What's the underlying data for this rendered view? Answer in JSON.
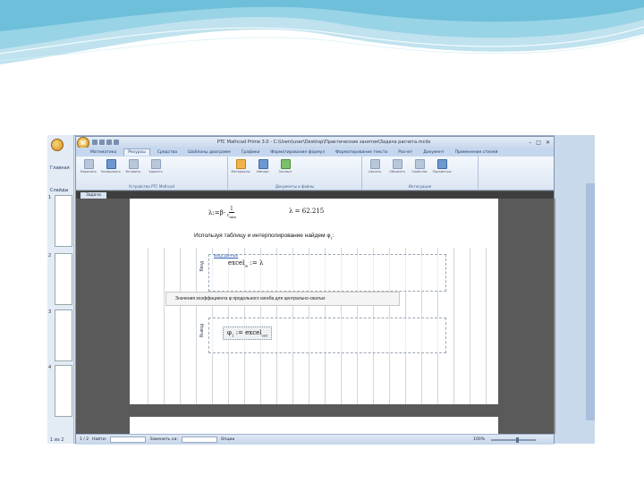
{
  "outer_window": {
    "panel_labels": [
      "Главная",
      "Слайды"
    ],
    "thumb_numbers": [
      "1",
      "2",
      "3",
      "4"
    ],
    "status_text": "1 из 2"
  },
  "mathcad": {
    "app_logo_letter": "M",
    "title": "PTC Mathcad Prime 3.0 - C:\\Users\\user\\Desktop\\Практические занятия\\Задача расчета.mcdx",
    "window_controls": {
      "minimize": "–",
      "maximize": "□",
      "close": "✕"
    },
    "tabs": [
      {
        "label": "Математика",
        "active": false
      },
      {
        "label": "Ресурсы",
        "active": true
      },
      {
        "label": "Средства",
        "active": false
      },
      {
        "label": "Шаблоны диаграмм",
        "active": false
      },
      {
        "label": "Графики",
        "active": false
      },
      {
        "label": "Форматирование формул",
        "active": false
      },
      {
        "label": "Форматирование текста",
        "active": false
      },
      {
        "label": "Расчет",
        "active": false
      },
      {
        "label": "Документ",
        "active": false
      },
      {
        "label": "Применение стилей",
        "active": false
      }
    ],
    "ribbon_groups": [
      {
        "label": "Устройства PTC Mathcad",
        "buttons": [
          {
            "label": "Вырезать",
            "icon": "cut-icon",
            "color": "grey"
          },
          {
            "label": "Копировать",
            "icon": "copy-icon",
            "color": "blue"
          },
          {
            "label": "Вставить",
            "icon": "paste-icon",
            "color": "grey"
          },
          {
            "label": "Удалить",
            "icon": "delete-icon",
            "color": "grey"
          }
        ]
      },
      {
        "label": "Документы и файлы",
        "buttons": [
          {
            "label": "Материалы",
            "icon": "folder-icon",
            "color": "orange"
          },
          {
            "label": "Импорт",
            "icon": "import-icon",
            "color": "blue"
          },
          {
            "label": "Экспорт",
            "icon": "export-icon",
            "color": "green"
          }
        ]
      },
      {
        "label": "Интеграция",
        "buttons": [
          {
            "label": "Связать",
            "icon": "link-icon",
            "color": "grey"
          },
          {
            "label": "Обновить",
            "icon": "refresh-icon",
            "color": "grey"
          },
          {
            "label": "Свойства",
            "icon": "properties-icon",
            "color": "grey"
          },
          {
            "label": "Параметры",
            "icon": "settings-icon",
            "color": "blue"
          }
        ]
      }
    ],
    "document_tab": "Задача",
    "content": {
      "line1_lhs": "λ:=β·",
      "line1_num": "l",
      "line1_den": "r",
      "line1_den_sub": "min",
      "line1_result": "λ = 62.215",
      "instruction": "Используя таблицу и интерполирование найдем φ",
      "instruction_sub": "1",
      "instruction_suffix": ":",
      "region1_tag": "Ввод",
      "region1_link": "ввод данных",
      "region1_expr": "excel",
      "region1_expr_sub": "in",
      "region1_expr_rhs": ":= λ",
      "table_caption": "Значения коэффициента φ продольного изгиба для центрально-сжатых",
      "region2_tag": "Вывод",
      "region2_expr_lhs": "φ",
      "region2_expr_lhs_sub": "1",
      "region2_expr_rhs": ":= excel",
      "region2_expr_rhs_sub": "out"
    },
    "status": {
      "page": "1 / 2",
      "label_find": "Найти:",
      "label_replace": "Заменить на:",
      "label_options": "Опции",
      "zoom": "100%"
    }
  }
}
